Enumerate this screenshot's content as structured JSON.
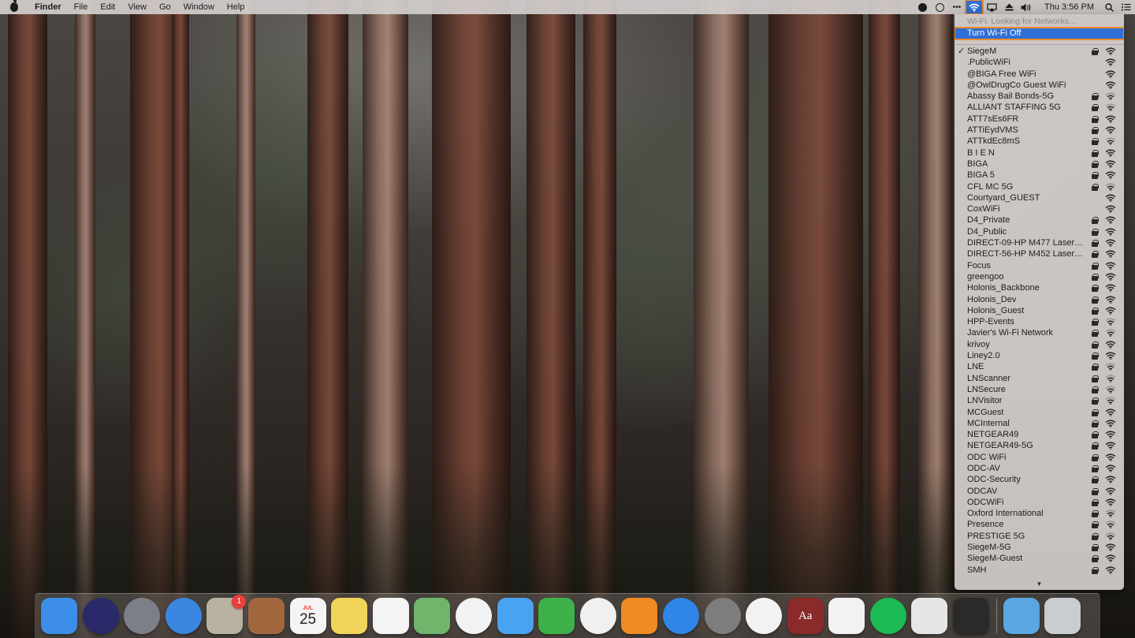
{
  "menubar": {
    "app_name": "Finder",
    "menus": [
      "File",
      "Edit",
      "View",
      "Go",
      "Window",
      "Help"
    ],
    "clock": "Thu 3:56 PM",
    "status_icons": [
      "creative-cloud-icon",
      "time-machine-icon",
      "more-icon",
      "wifi-icon",
      "airplay-icon",
      "eject-icon",
      "volume-icon"
    ]
  },
  "wifi_menu": {
    "header": "Wi-Fi: Looking for Networks...",
    "toggle_label": "Turn Wi-Fi Off",
    "networks": [
      {
        "name": "SiegeM",
        "locked": true,
        "connected": true,
        "strength": 3
      },
      {
        "name": ".PublicWiFi",
        "locked": false,
        "strength": 3
      },
      {
        "name": "@BIGA Free WiFi",
        "locked": false,
        "strength": 3
      },
      {
        "name": "@OwlDrugCo Guest WiFi",
        "locked": false,
        "strength": 3
      },
      {
        "name": "Abassy Bail Bonds-5G",
        "locked": true,
        "strength": 2
      },
      {
        "name": "ALLIANT STAFFING 5G",
        "locked": true,
        "strength": 2
      },
      {
        "name": "ATT7sEs6FR",
        "locked": true,
        "strength": 3
      },
      {
        "name": "ATTiEydVMS",
        "locked": true,
        "strength": 3
      },
      {
        "name": "ATTkdEc8mS",
        "locked": true,
        "strength": 2
      },
      {
        "name": "B I E N",
        "locked": true,
        "strength": 3
      },
      {
        "name": "BIGA",
        "locked": true,
        "strength": 3
      },
      {
        "name": "BIGA 5",
        "locked": true,
        "strength": 3
      },
      {
        "name": "CFL MC 5G",
        "locked": true,
        "strength": 2
      },
      {
        "name": "Courtyard_GUEST",
        "locked": false,
        "strength": 3
      },
      {
        "name": "CoxWiFi",
        "locked": false,
        "strength": 3
      },
      {
        "name": "D4_Private",
        "locked": true,
        "strength": 3
      },
      {
        "name": "D4_Public",
        "locked": true,
        "strength": 3
      },
      {
        "name": "DIRECT-09-HP M477 LaserJ...",
        "locked": true,
        "strength": 3
      },
      {
        "name": "DIRECT-56-HP M452 LaserJ...",
        "locked": true,
        "strength": 3
      },
      {
        "name": "Focus",
        "locked": true,
        "strength": 3
      },
      {
        "name": "greengoo",
        "locked": true,
        "strength": 3
      },
      {
        "name": "Holonis_Backbone",
        "locked": true,
        "strength": 3
      },
      {
        "name": "Holonis_Dev",
        "locked": true,
        "strength": 3
      },
      {
        "name": "Holonis_Guest",
        "locked": true,
        "strength": 3
      },
      {
        "name": "HPP-Events",
        "locked": true,
        "strength": 2
      },
      {
        "name": "Javier's Wi-Fi Network",
        "locked": true,
        "strength": 2
      },
      {
        "name": "krivoy",
        "locked": true,
        "strength": 3
      },
      {
        "name": "Liney2.0",
        "locked": true,
        "strength": 3
      },
      {
        "name": "LNE",
        "locked": true,
        "strength": 2
      },
      {
        "name": "LNScanner",
        "locked": true,
        "strength": 2
      },
      {
        "name": "LNSecure",
        "locked": true,
        "strength": 2
      },
      {
        "name": "LNVisitor",
        "locked": true,
        "strength": 2
      },
      {
        "name": "MCGuest",
        "locked": true,
        "strength": 3
      },
      {
        "name": "MCInternal",
        "locked": true,
        "strength": 3
      },
      {
        "name": "NETGEAR49",
        "locked": true,
        "strength": 3
      },
      {
        "name": "NETGEAR49-5G",
        "locked": true,
        "strength": 3
      },
      {
        "name": "ODC WiFi",
        "locked": true,
        "strength": 3
      },
      {
        "name": "ODC-AV",
        "locked": true,
        "strength": 3
      },
      {
        "name": "ODC-Security",
        "locked": true,
        "strength": 3
      },
      {
        "name": "ODCAV",
        "locked": true,
        "strength": 3
      },
      {
        "name": "ODCWiFi",
        "locked": true,
        "strength": 3
      },
      {
        "name": "Oxford International",
        "locked": true,
        "strength": 2
      },
      {
        "name": "Presence",
        "locked": true,
        "strength": 2
      },
      {
        "name": "PRESTIGE 5G",
        "locked": true,
        "strength": 2
      },
      {
        "name": "SiegeM-5G",
        "locked": true,
        "strength": 3
      },
      {
        "name": "SiegeM-Guest",
        "locked": true,
        "strength": 3
      },
      {
        "name": "SMH",
        "locked": true,
        "strength": 3
      }
    ],
    "scroll_arrow": "▼"
  },
  "dock": {
    "calendar_month": "JUL",
    "calendar_day": "25",
    "mail_badge": "1",
    "dictionary_label": "Aa",
    "apps": [
      {
        "name": "finder-icon",
        "color": "#3d8ee8"
      },
      {
        "name": "siri-icon",
        "color": "#2a2a6a"
      },
      {
        "name": "launchpad-icon",
        "color": "#7a7f88"
      },
      {
        "name": "safari-icon",
        "color": "#3a86e0"
      },
      {
        "name": "mail-icon",
        "color": "#b9b2a0"
      },
      {
        "name": "contacts-icon",
        "color": "#a0673f"
      },
      {
        "name": "calendar-icon",
        "color": "#f4f4f4"
      },
      {
        "name": "notes-icon",
        "color": "#f1d55a"
      },
      {
        "name": "reminders-icon",
        "color": "#f4f4f4"
      },
      {
        "name": "maps-icon",
        "color": "#6fb56c"
      },
      {
        "name": "photos-icon",
        "color": "#f2f2f2"
      },
      {
        "name": "messages-icon",
        "color": "#4aa3f0"
      },
      {
        "name": "facetime-icon",
        "color": "#3fb14a"
      },
      {
        "name": "itunes-icon",
        "color": "#f0f0f0"
      },
      {
        "name": "ibooks-icon",
        "color": "#f08a24"
      },
      {
        "name": "app-store-icon",
        "color": "#2f86e6"
      },
      {
        "name": "system-preferences-icon",
        "color": "#7d7d7d"
      },
      {
        "name": "chrome-icon",
        "color": "#f2f2f2"
      },
      {
        "name": "dictionary-icon",
        "color": "#8b2a2a"
      },
      {
        "name": "slack-icon",
        "color": "#f2f2f2"
      },
      {
        "name": "spotify-icon",
        "color": "#1db954"
      },
      {
        "name": "script-editor-icon",
        "color": "#e6e6e6"
      },
      {
        "name": "activity-monitor-icon",
        "color": "#2a2a2a"
      },
      {
        "name": "downloads-folder-icon",
        "color": "#5aa6e0"
      },
      {
        "name": "trash-icon",
        "color": "#c9ccd0"
      }
    ]
  },
  "colors": {
    "highlight": "#2f6fd6",
    "focus_outline": "#ef8a2b",
    "badge": "#e8403a"
  }
}
